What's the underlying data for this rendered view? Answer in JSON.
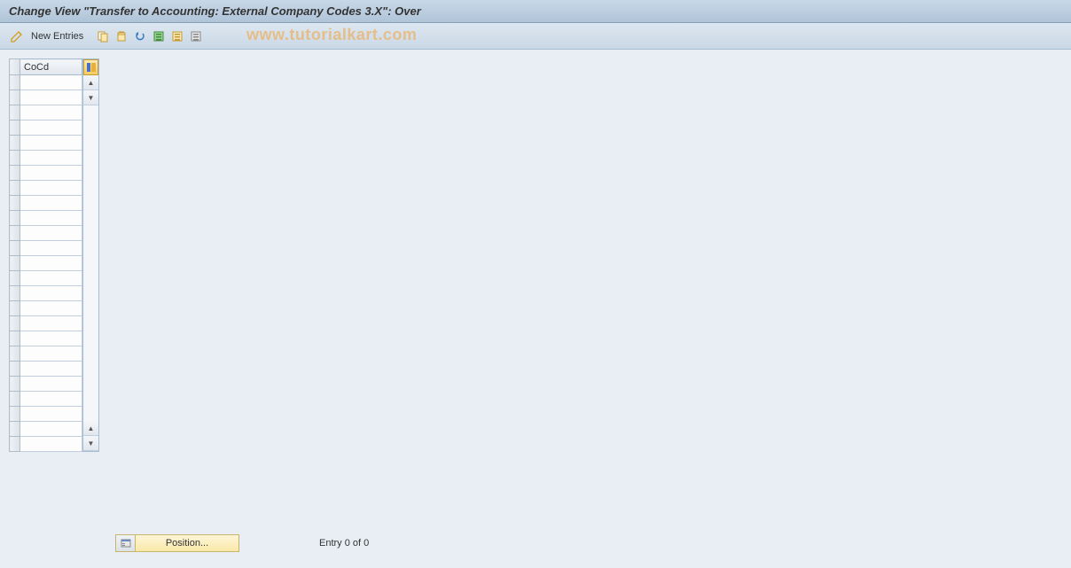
{
  "header": {
    "title": "Change View \"Transfer to Accounting: External Company Codes 3.X\": Over"
  },
  "toolbar": {
    "new_entries_label": "New Entries"
  },
  "watermark": "www.tutorialkart.com",
  "table": {
    "columns": {
      "cocd": "CoCd"
    },
    "row_count": 25
  },
  "footer": {
    "position_label": "Position...",
    "entry_text": "Entry 0 of 0"
  }
}
